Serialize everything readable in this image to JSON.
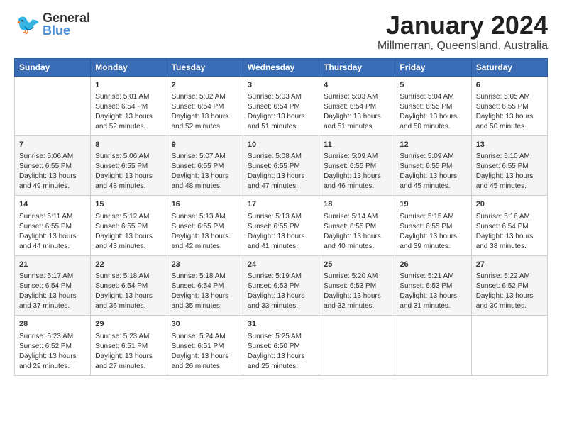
{
  "header": {
    "logo_general": "General",
    "logo_blue": "Blue",
    "title": "January 2024",
    "subtitle": "Millmerran, Queensland, Australia"
  },
  "days_of_week": [
    "Sunday",
    "Monday",
    "Tuesday",
    "Wednesday",
    "Thursday",
    "Friday",
    "Saturday"
  ],
  "weeks": [
    [
      {
        "day": "",
        "sunrise": "",
        "sunset": "",
        "daylight": ""
      },
      {
        "day": "1",
        "sunrise": "Sunrise: 5:01 AM",
        "sunset": "Sunset: 6:54 PM",
        "daylight": "Daylight: 13 hours and 52 minutes."
      },
      {
        "day": "2",
        "sunrise": "Sunrise: 5:02 AM",
        "sunset": "Sunset: 6:54 PM",
        "daylight": "Daylight: 13 hours and 52 minutes."
      },
      {
        "day": "3",
        "sunrise": "Sunrise: 5:03 AM",
        "sunset": "Sunset: 6:54 PM",
        "daylight": "Daylight: 13 hours and 51 minutes."
      },
      {
        "day": "4",
        "sunrise": "Sunrise: 5:03 AM",
        "sunset": "Sunset: 6:54 PM",
        "daylight": "Daylight: 13 hours and 51 minutes."
      },
      {
        "day": "5",
        "sunrise": "Sunrise: 5:04 AM",
        "sunset": "Sunset: 6:55 PM",
        "daylight": "Daylight: 13 hours and 50 minutes."
      },
      {
        "day": "6",
        "sunrise": "Sunrise: 5:05 AM",
        "sunset": "Sunset: 6:55 PM",
        "daylight": "Daylight: 13 hours and 50 minutes."
      }
    ],
    [
      {
        "day": "7",
        "sunrise": "Sunrise: 5:06 AM",
        "sunset": "Sunset: 6:55 PM",
        "daylight": "Daylight: 13 hours and 49 minutes."
      },
      {
        "day": "8",
        "sunrise": "Sunrise: 5:06 AM",
        "sunset": "Sunset: 6:55 PM",
        "daylight": "Daylight: 13 hours and 48 minutes."
      },
      {
        "day": "9",
        "sunrise": "Sunrise: 5:07 AM",
        "sunset": "Sunset: 6:55 PM",
        "daylight": "Daylight: 13 hours and 48 minutes."
      },
      {
        "day": "10",
        "sunrise": "Sunrise: 5:08 AM",
        "sunset": "Sunset: 6:55 PM",
        "daylight": "Daylight: 13 hours and 47 minutes."
      },
      {
        "day": "11",
        "sunrise": "Sunrise: 5:09 AM",
        "sunset": "Sunset: 6:55 PM",
        "daylight": "Daylight: 13 hours and 46 minutes."
      },
      {
        "day": "12",
        "sunrise": "Sunrise: 5:09 AM",
        "sunset": "Sunset: 6:55 PM",
        "daylight": "Daylight: 13 hours and 45 minutes."
      },
      {
        "day": "13",
        "sunrise": "Sunrise: 5:10 AM",
        "sunset": "Sunset: 6:55 PM",
        "daylight": "Daylight: 13 hours and 45 minutes."
      }
    ],
    [
      {
        "day": "14",
        "sunrise": "Sunrise: 5:11 AM",
        "sunset": "Sunset: 6:55 PM",
        "daylight": "Daylight: 13 hours and 44 minutes."
      },
      {
        "day": "15",
        "sunrise": "Sunrise: 5:12 AM",
        "sunset": "Sunset: 6:55 PM",
        "daylight": "Daylight: 13 hours and 43 minutes."
      },
      {
        "day": "16",
        "sunrise": "Sunrise: 5:13 AM",
        "sunset": "Sunset: 6:55 PM",
        "daylight": "Daylight: 13 hours and 42 minutes."
      },
      {
        "day": "17",
        "sunrise": "Sunrise: 5:13 AM",
        "sunset": "Sunset: 6:55 PM",
        "daylight": "Daylight: 13 hours and 41 minutes."
      },
      {
        "day": "18",
        "sunrise": "Sunrise: 5:14 AM",
        "sunset": "Sunset: 6:55 PM",
        "daylight": "Daylight: 13 hours and 40 minutes."
      },
      {
        "day": "19",
        "sunrise": "Sunrise: 5:15 AM",
        "sunset": "Sunset: 6:55 PM",
        "daylight": "Daylight: 13 hours and 39 minutes."
      },
      {
        "day": "20",
        "sunrise": "Sunrise: 5:16 AM",
        "sunset": "Sunset: 6:54 PM",
        "daylight": "Daylight: 13 hours and 38 minutes."
      }
    ],
    [
      {
        "day": "21",
        "sunrise": "Sunrise: 5:17 AM",
        "sunset": "Sunset: 6:54 PM",
        "daylight": "Daylight: 13 hours and 37 minutes."
      },
      {
        "day": "22",
        "sunrise": "Sunrise: 5:18 AM",
        "sunset": "Sunset: 6:54 PM",
        "daylight": "Daylight: 13 hours and 36 minutes."
      },
      {
        "day": "23",
        "sunrise": "Sunrise: 5:18 AM",
        "sunset": "Sunset: 6:54 PM",
        "daylight": "Daylight: 13 hours and 35 minutes."
      },
      {
        "day": "24",
        "sunrise": "Sunrise: 5:19 AM",
        "sunset": "Sunset: 6:53 PM",
        "daylight": "Daylight: 13 hours and 33 minutes."
      },
      {
        "day": "25",
        "sunrise": "Sunrise: 5:20 AM",
        "sunset": "Sunset: 6:53 PM",
        "daylight": "Daylight: 13 hours and 32 minutes."
      },
      {
        "day": "26",
        "sunrise": "Sunrise: 5:21 AM",
        "sunset": "Sunset: 6:53 PM",
        "daylight": "Daylight: 13 hours and 31 minutes."
      },
      {
        "day": "27",
        "sunrise": "Sunrise: 5:22 AM",
        "sunset": "Sunset: 6:52 PM",
        "daylight": "Daylight: 13 hours and 30 minutes."
      }
    ],
    [
      {
        "day": "28",
        "sunrise": "Sunrise: 5:23 AM",
        "sunset": "Sunset: 6:52 PM",
        "daylight": "Daylight: 13 hours and 29 minutes."
      },
      {
        "day": "29",
        "sunrise": "Sunrise: 5:23 AM",
        "sunset": "Sunset: 6:51 PM",
        "daylight": "Daylight: 13 hours and 27 minutes."
      },
      {
        "day": "30",
        "sunrise": "Sunrise: 5:24 AM",
        "sunset": "Sunset: 6:51 PM",
        "daylight": "Daylight: 13 hours and 26 minutes."
      },
      {
        "day": "31",
        "sunrise": "Sunrise: 5:25 AM",
        "sunset": "Sunset: 6:50 PM",
        "daylight": "Daylight: 13 hours and 25 minutes."
      },
      {
        "day": "",
        "sunrise": "",
        "sunset": "",
        "daylight": ""
      },
      {
        "day": "",
        "sunrise": "",
        "sunset": "",
        "daylight": ""
      },
      {
        "day": "",
        "sunrise": "",
        "sunset": "",
        "daylight": ""
      }
    ]
  ]
}
